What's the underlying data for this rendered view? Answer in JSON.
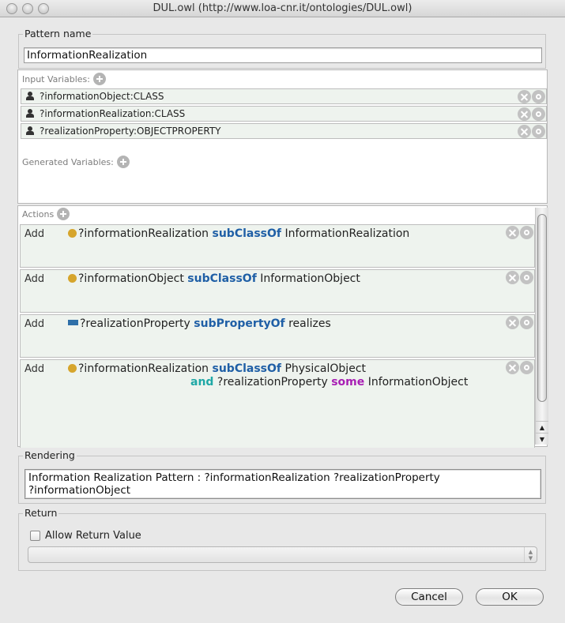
{
  "window": {
    "title": "DUL.owl (http://www.loa-cnr.it/ontologies/DUL.owl)"
  },
  "pattern_name": {
    "label": "Pattern name",
    "value": "InformationRealization"
  },
  "input_variables": {
    "label": "Input Variables:",
    "items": [
      {
        "icon": "person-icon",
        "text": "?informationObject:CLASS"
      },
      {
        "icon": "person-icon",
        "text": "?informationRealization:CLASS"
      },
      {
        "icon": "person-icon",
        "text": "?realizationProperty:OBJECTPROPERTY"
      }
    ]
  },
  "generated_variables": {
    "label": "Generated Variables:",
    "items": []
  },
  "actions": {
    "label": "Actions",
    "items": [
      {
        "type": "Add",
        "icon": "class-icon",
        "subject": "?informationRealization",
        "keyword": "subClassOf",
        "object": "InformationRealization"
      },
      {
        "type": "Add",
        "icon": "class-icon",
        "subject": "?informationObject",
        "keyword": "subClassOf",
        "object": "InformationObject"
      },
      {
        "type": "Add",
        "icon": "property-icon",
        "subject": "?realizationProperty",
        "keyword": "subPropertyOf",
        "object": "realizes"
      },
      {
        "type": "Add",
        "icon": "class-icon",
        "subject": "?informationRealization",
        "keyword": "subClassOf",
        "object": "PhysicalObject",
        "line2": {
          "and_keyword": "and",
          "property": "?realizationProperty",
          "some_keyword": "some",
          "filler": "InformationObject"
        }
      }
    ]
  },
  "rendering": {
    "label": "Rendering",
    "line1": "Information Realization Pattern : ?informationRealization ?realizationProperty",
    "line2": "?informationObject"
  },
  "return": {
    "label": "Return",
    "checkbox_label": "Allow Return Value",
    "checked": false,
    "selected_value": ""
  },
  "buttons": {
    "cancel": "Cancel",
    "ok": "OK"
  },
  "colors": {
    "keyword_blue": "#1f5fa6",
    "keyword_teal": "#1fa8a6",
    "keyword_purple": "#a81fb4",
    "class_icon": "#d6a52c",
    "property_icon": "#2e6fa8",
    "row_background": "#eef3ee"
  }
}
